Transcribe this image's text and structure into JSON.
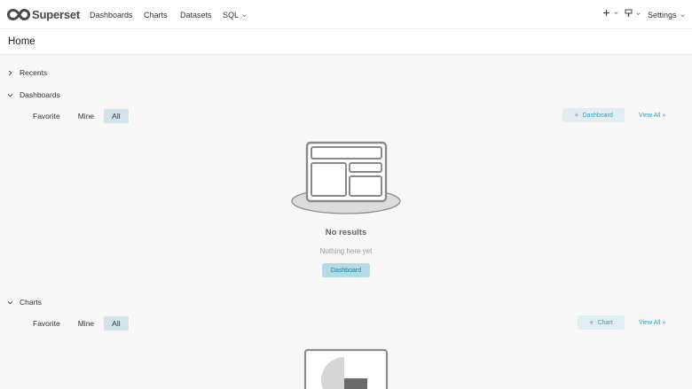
{
  "brand": {
    "name": "Superset"
  },
  "nav": {
    "items": [
      "Dashboards",
      "Charts",
      "Datasets",
      "SQL"
    ],
    "settings_label": "Settings"
  },
  "header": {
    "title": "Home"
  },
  "sections": {
    "recents": {
      "label": "Recents"
    },
    "dashboards": {
      "label": "Dashboards",
      "tabs": [
        "Favorite",
        "Mine",
        "All"
      ],
      "active_tab": "All",
      "add_label": "Dashboard",
      "view_all": "View All »",
      "empty_title": "No results",
      "empty_sub": "Nothing here yet",
      "empty_button": "Dashboard"
    },
    "charts": {
      "label": "Charts",
      "tabs": [
        "Favorite",
        "Mine",
        "All"
      ],
      "active_tab": "All",
      "add_label": "Chart",
      "view_all": "View All »"
    }
  },
  "colors": {
    "accent": "#20a7c9",
    "active_tab": "#d1e4ea",
    "add_button": "#e0eef2"
  }
}
